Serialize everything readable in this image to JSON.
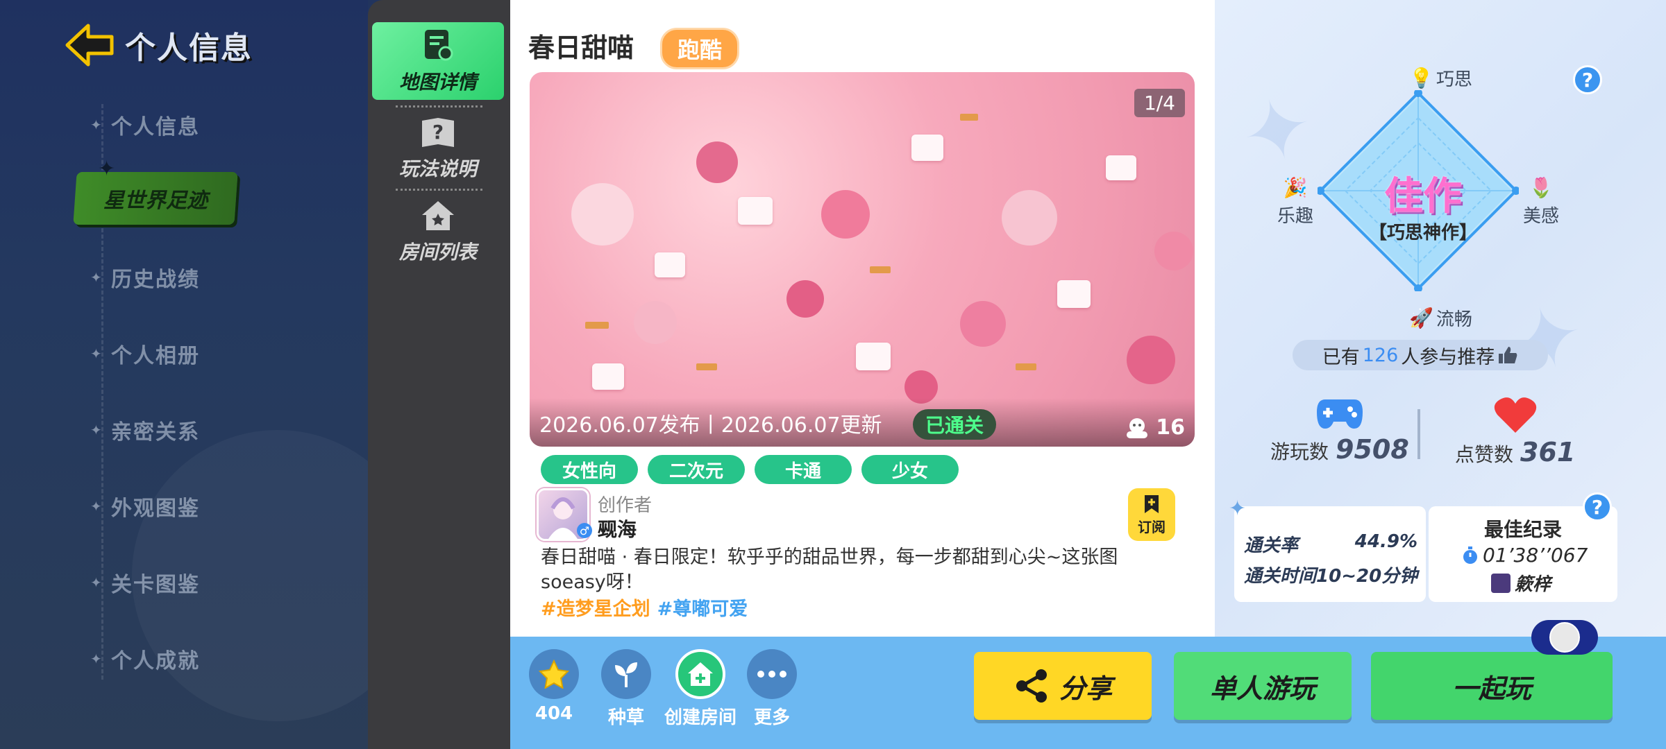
{
  "nav": {
    "title": "个人信息",
    "items": [
      "个人信息",
      "星世界足迹",
      "历史战绩",
      "个人相册",
      "亲密关系",
      "外观图鉴",
      "关卡图鉴",
      "个人成就"
    ],
    "active": "星世界足迹"
  },
  "tabs": [
    "地图详情",
    "玩法说明",
    "房间列表"
  ],
  "map": {
    "title": "春日甜喵",
    "type": "跑酷",
    "page_indicator": "1/4",
    "dates": "2026.06.07发布丨2026.06.07更新",
    "status": "已通关",
    "online_count": "16",
    "tags": [
      "女性向",
      "二次元",
      "卡通",
      "少女"
    ],
    "creator_label": "创作者",
    "creator_name": "觋海",
    "subscribe_label": "订阅",
    "description": "春日甜喵 · 春日限定！软乎乎的甜品世界，每一步都甜到心尖~这张图soeasy呀！",
    "hashtags": [
      "#造梦星企划",
      "#尊嘟可爱"
    ]
  },
  "rating": {
    "axes": {
      "top": "巧思",
      "left": "乐趣",
      "right": "美感",
      "bottom": "流畅"
    },
    "grade": "佳作",
    "subtitle": "【巧思神作】",
    "recommend_prefix": "已有",
    "recommend_count": "126",
    "recommend_suffix": "人参与推荐"
  },
  "stats": {
    "plays_label": "游玩数",
    "plays_value": "9508",
    "likes_label": "点赞数",
    "likes_value": "361"
  },
  "pass": {
    "rate_label": "通关率",
    "rate_value": "44.9%",
    "time_label": "通关时间",
    "time_value": "10~20分钟"
  },
  "best": {
    "title": "最佳纪录",
    "time": "01’38’’067",
    "holder": "簌梓"
  },
  "help_icon": "?",
  "actions": [
    {
      "label": "404",
      "icon": "star-icon"
    },
    {
      "label": "种草",
      "icon": "sprout-icon"
    },
    {
      "label": "创建房间",
      "icon": "home-plus-icon"
    },
    {
      "label": "更多",
      "icon": "more-icon"
    }
  ],
  "buttons": {
    "share": "分享",
    "solo": "单人游玩",
    "together": "一起玩"
  },
  "colors": {
    "accent_green": "#27c48a",
    "accent_yellow": "#ffd725",
    "accent_orange": "#ffa646",
    "accent_blue": "#3b8df2",
    "rating_pink": "#ff6fcf"
  }
}
